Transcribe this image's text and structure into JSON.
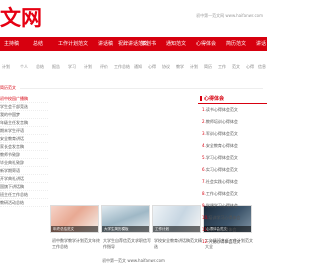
{
  "header": {
    "logo": "文网",
    "url_text": "初中第一范文网 www.haifanwr.com"
  },
  "nav": {
    "items": [
      "主持稿",
      "总结",
      "工作计划范文",
      "讲话稿",
      "祝辞讲话范文",
      "策划书",
      "通知范文",
      "心得体会",
      "简历范文",
      "讲话"
    ]
  },
  "subnav": {
    "items": [
      "计划",
      "个人",
      "总结",
      "报告",
      "学习",
      "计划",
      "评价",
      "工作总结",
      "通知",
      "心得",
      "协议",
      "教学",
      "计划",
      "简历",
      "工作",
      "范文",
      "心得",
      "信息"
    ]
  },
  "section": {
    "caption": "简历范文"
  },
  "left_list": {
    "items": [
      "初中校园广播稿",
      "学生会干部竞选",
      "我的中国梦",
      "年级主任发言稿",
      "期末学生评语",
      "安全教育讲话",
      "家长会发言稿",
      "教师节致辞",
      "毕业典礼致辞",
      "新学期寄语",
      "开学典礼讲话",
      "国旗下讲话稿",
      "班主任工作总结",
      "教研活动总结"
    ]
  },
  "thumbs": {
    "items": [
      {
        "caption": "年终总结范文"
      },
      {
        "caption": "大学生简历模板"
      },
      {
        "caption": "工作计划"
      },
      {
        "caption": "心得体会范文"
      }
    ]
  },
  "captions": {
    "items": [
      "初中数学教学计划范文年终工作总结",
      "大学生自荐信范文求职信写作指导",
      "学校安全教育讲话稿范文精选",
      "二年级班主任工作计划范文大全"
    ]
  },
  "sidebar": {
    "title": "心得体会",
    "items": [
      {
        "num": "1.",
        "text": "读书心得体会范文"
      },
      {
        "num": "2.",
        "text": "教师培训心得体会"
      },
      {
        "num": "3.",
        "text": "军训心得体会范文"
      },
      {
        "num": "4.",
        "text": "安全教育心得体会"
      },
      {
        "num": "5.",
        "text": "学习心得体会范文"
      },
      {
        "num": "6.",
        "text": "实习心得体会范文"
      },
      {
        "num": "7.",
        "text": "社会实践心得体会"
      },
      {
        "num": "8.",
        "text": "工作心得体会范文"
      },
      {
        "num": "9.",
        "text": "党课学习心得体会"
      },
      {
        "num": "10.",
        "text": "培训学习心得体会"
      },
      {
        "num": "11.",
        "text": "大学生心得体会"
      },
      {
        "num": "12.",
        "text": "入党心得体会范文"
      }
    ]
  },
  "footer": {
    "text": "初中第一范文 www.haifanwr.com"
  },
  "colors": {
    "brand_red": "#d7000f",
    "logo_red": "#e60012"
  }
}
